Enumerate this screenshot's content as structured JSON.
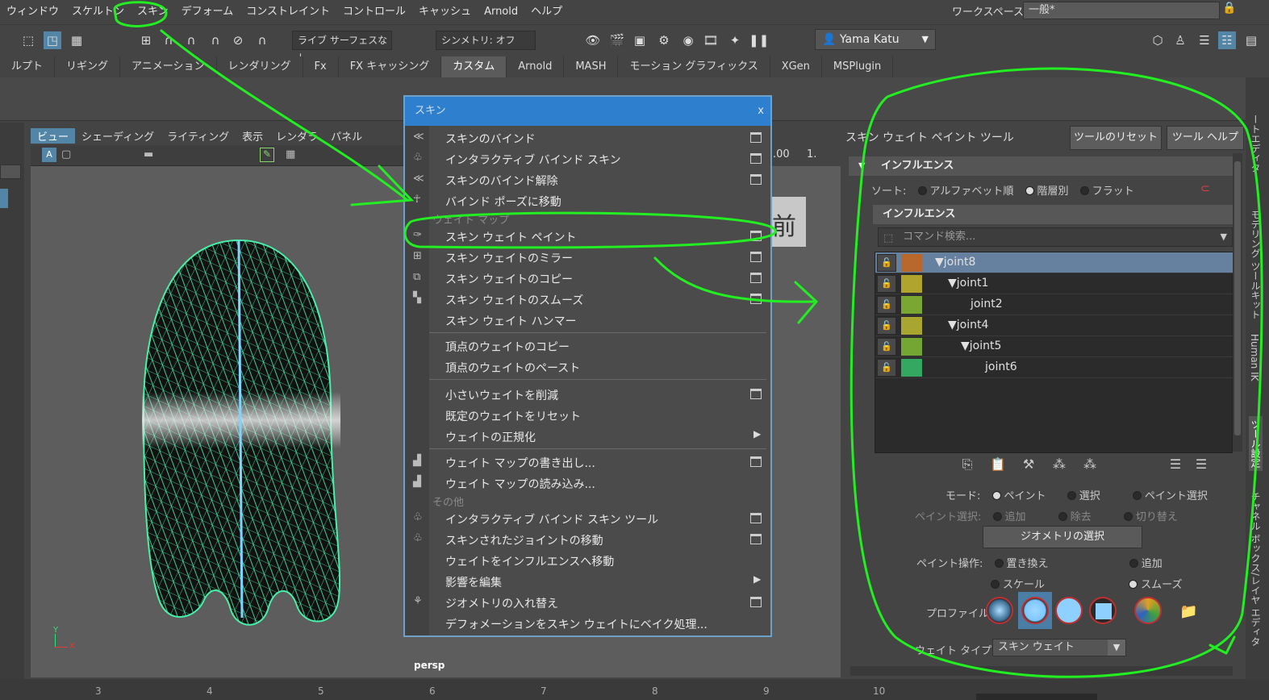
{
  "menubar": {
    "items": [
      "ウィンドウ",
      "スケルトン",
      "スキン",
      "デフォーム",
      "コンストレイント",
      "コントロール",
      "キャッシュ",
      "Arnold",
      "ヘルプ"
    ],
    "workspace_label": "ワークスペース:",
    "workspace_value": "一般*"
  },
  "statusbar": {
    "live_surface": "ライブ サーフェスなし",
    "symmetry": "シンメトリ: オフ",
    "user": "Yama Katu"
  },
  "shelf_tabs": [
    "ルプト",
    "リギング",
    "アニメーション",
    "レンダリング",
    "Fx",
    "FX キャッシング",
    "カスタム",
    "Arnold",
    "MASH",
    "モーション グラフィックス",
    "XGen",
    "MSPlugin"
  ],
  "shelf_active": "カスタム",
  "viewport": {
    "menu": [
      "ビュー",
      "シェーディング",
      "ライティング",
      "表示",
      "レンダラ",
      "パネル"
    ],
    "camera": "persp",
    "field_value": ".00",
    "field_value2": "1.",
    "axis_y": "Y",
    "axis_x": "X",
    "behind_text": "前"
  },
  "skin_menu": {
    "title": "スキン",
    "close": "x",
    "section_weight_maps": "ウェイト マップ",
    "section_other": "その他",
    "items": [
      {
        "label": "スキンのバインド",
        "box": true
      },
      {
        "label": "インタラクティブ バインド スキン",
        "box": true
      },
      {
        "label": "スキンのバインド解除",
        "box": true
      },
      {
        "label": "バインド ポーズに移動",
        "box": false
      },
      {
        "label": "スキン ウェイト ペイント",
        "box": true
      },
      {
        "label": "スキン ウェイトのミラー",
        "box": true
      },
      {
        "label": "スキン ウェイトのコピー",
        "box": true
      },
      {
        "label": "スキン ウェイトのスムーズ",
        "box": true
      },
      {
        "label": "スキン ウェイト ハンマー",
        "box": false
      },
      {
        "label": "頂点のウェイトのコピー",
        "box": false
      },
      {
        "label": "頂点のウェイトのペースト",
        "box": false
      },
      {
        "label": "小さいウェイトを削減",
        "box": true
      },
      {
        "label": "既定のウェイトをリセット",
        "box": false
      },
      {
        "label": "ウェイトの正規化",
        "arrow": true
      },
      {
        "label": "ウェイト マップの書き出し...",
        "box": true
      },
      {
        "label": "ウェイト マップの読み込み...",
        "box": false
      },
      {
        "label": "インタラクティブ バインド スキン ツール",
        "box": true
      },
      {
        "label": "スキンされたジョイントの移動",
        "box": true
      },
      {
        "label": "ウェイトをインフルエンスへ移動",
        "box": false
      },
      {
        "label": "影響を編集",
        "arrow": true
      },
      {
        "label": "ジオメトリの入れ替え",
        "box": true
      },
      {
        "label": "デフォメーションをスキン ウェイトにベイク処理...",
        "box": false
      }
    ]
  },
  "tool_panel": {
    "title": "スキン ウェイト ペイント ツール",
    "reset_button": "ツールのリセット",
    "help_button": "ツール ヘルプ",
    "influence_header": "インフルエンス",
    "sort_label": "ソート:",
    "sort_options": [
      "アルファベット順",
      "階層別",
      "フラット"
    ],
    "sort_selected": "階層別",
    "influence_sub": "インフルエンス",
    "search_placeholder": "コマンド検索...",
    "joints": [
      {
        "name": "joint8",
        "color": "#b8682a",
        "selected": true
      },
      {
        "name": "joint1",
        "color": "#b0a42c",
        "selected": false
      },
      {
        "name": "joint2",
        "color": "#7aa632",
        "selected": false
      },
      {
        "name": "joint4",
        "color": "#a8a630",
        "selected": false
      },
      {
        "name": "joint5",
        "color": "#74a634",
        "selected": false
      },
      {
        "name": "joint6",
        "color": "#32a860",
        "selected": false
      }
    ],
    "mode_label": "モード:",
    "mode_options": [
      "ペイント",
      "選択",
      "ペイント選択"
    ],
    "paint_select_label": "ペイント選択:",
    "paint_select_options": [
      "追加",
      "除去",
      "切り替え"
    ],
    "select_geometry_button": "ジオメトリの選択",
    "paint_op_label": "ペイント操作:",
    "paint_op_options": [
      "置き換え",
      "追加",
      "スケール",
      "スムーズ"
    ],
    "paint_op_selected": "スムーズ",
    "profile_label": "プロファイル:",
    "weight_type_label": "ウェイト タイプ:",
    "weight_type_value": "スキン ウェイト"
  },
  "side_tabs": [
    "ートエディタ",
    "モデリング ツールキット",
    "Human IK",
    "ツール設定",
    "チャネル ボックス/レイヤ エディタ"
  ],
  "timeline_ticks": [
    "3",
    "4",
    "5",
    "6",
    "7",
    "8",
    "9",
    "10"
  ]
}
